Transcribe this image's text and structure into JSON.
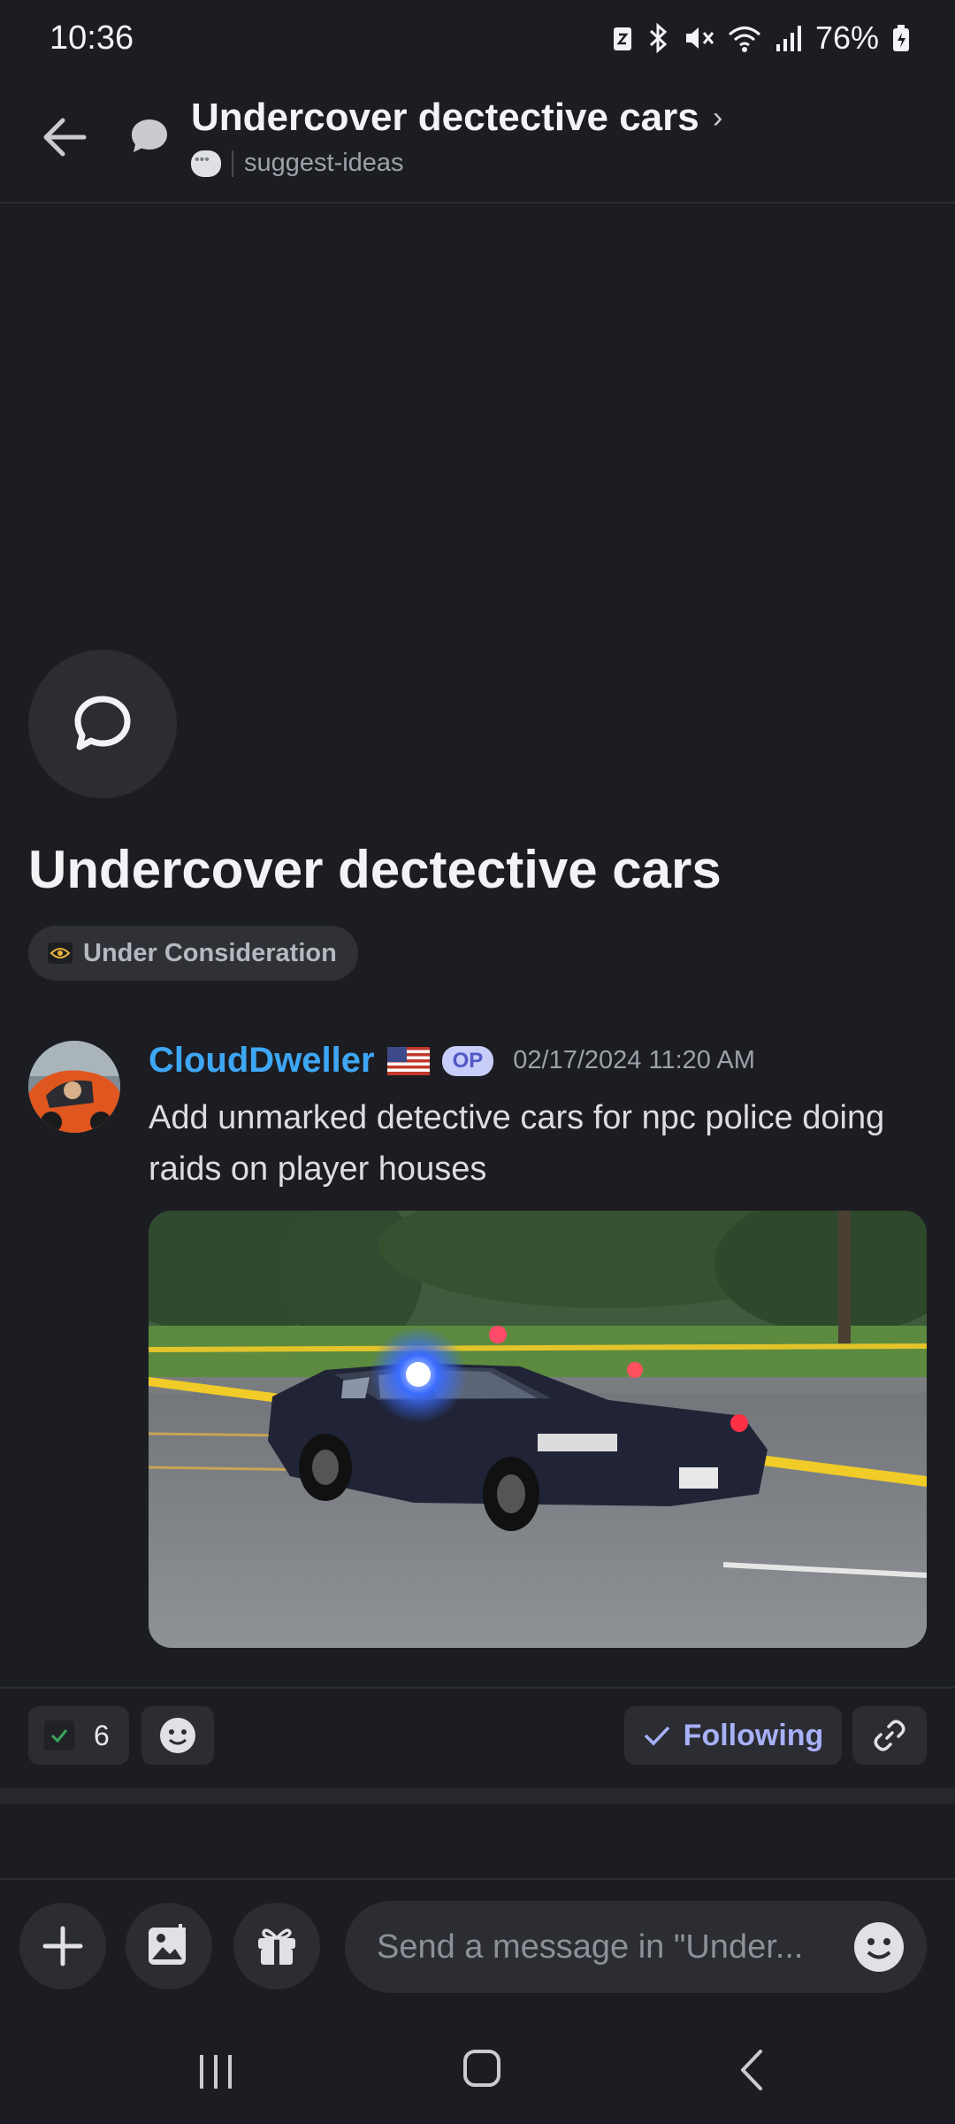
{
  "status_bar": {
    "time": "10:36",
    "battery": "76%"
  },
  "header": {
    "title": "Undercover dectective cars",
    "chevron": "›",
    "channel": "suggest-ideas"
  },
  "thread": {
    "title": "Undercover dectective cars",
    "tag": "Under Consideration"
  },
  "message": {
    "author": "CloudDweller",
    "badge": "OP",
    "timestamp": "02/17/2024 11:20 AM",
    "text": "Add unmarked detective cars for npc police doing raids on player houses",
    "attachment_icon": "police-car-photo"
  },
  "reactions": {
    "count": "6",
    "follow_label": "Following"
  },
  "composer": {
    "placeholder": "Send a message in \"Under..."
  },
  "colors": {
    "background": "#1c1d22",
    "surface": "#2b2d33",
    "author": "#3ea7f5",
    "accent": "#a8b0f8",
    "badge_bg": "#c9cdf9"
  }
}
